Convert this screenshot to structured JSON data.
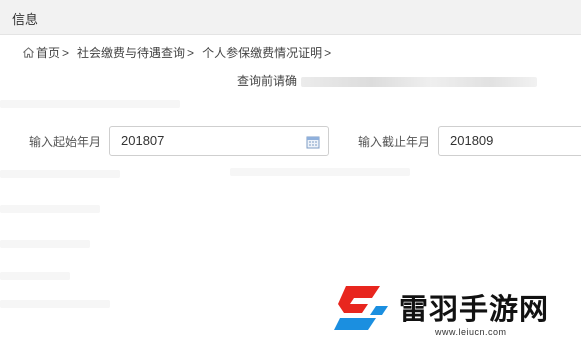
{
  "header": {
    "title": "信息"
  },
  "breadcrumb": {
    "items": [
      {
        "label": "首页",
        "sep": ">"
      },
      {
        "label": "社会缴费与待遇查询",
        "sep": ">"
      },
      {
        "label": "个人参保缴费情况证明",
        "sep": ">"
      }
    ]
  },
  "notice": {
    "text": "查询前请确"
  },
  "form": {
    "start": {
      "label": "输入起始年月",
      "value": "201807"
    },
    "end": {
      "label": "输入截止年月",
      "value": "201809"
    }
  },
  "watermark": {
    "brand": "雷羽手游网",
    "url": "www.leiucn.com"
  },
  "colors": {
    "topbar": "#f2f2f2",
    "logo_red": "#e8261e",
    "logo_blue": "#1b8fe0"
  }
}
